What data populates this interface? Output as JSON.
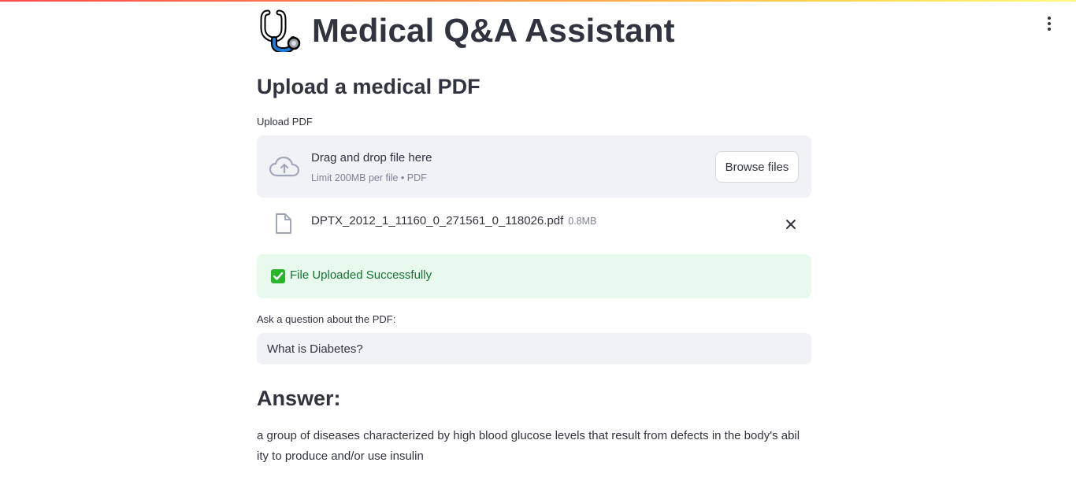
{
  "app": {
    "title": "Medical Q&A Assistant",
    "title_icon": "stethoscope-icon",
    "menu_icon": "vertical-ellipsis-icon",
    "accent_gradient": [
      "#ff4b4b",
      "#ffd24b",
      "#fffd80"
    ]
  },
  "upload": {
    "subheader": "Upload a medical PDF",
    "label": "Upload PDF",
    "dropzone_title": "Drag and drop file here",
    "dropzone_limit": "Limit 200MB per file • PDF",
    "browse_label": "Browse files",
    "upload_icon": "cloud-upload-icon"
  },
  "file": {
    "name": "DPTX_2012_1_11160_0_271561_0_118026.pdf",
    "size": "0.8MB",
    "icon": "document-icon",
    "remove_icon": "close-icon"
  },
  "status": {
    "message": "File Uploaded Successfully",
    "icon": "check-mark-button-icon",
    "color": "#177233",
    "background": "#e8f9ee"
  },
  "question": {
    "label": "Ask a question about the PDF:",
    "value": "What is Diabetes?"
  },
  "answer": {
    "heading": "Answer:",
    "text": "a group of diseases characterized by high blood glucose levels that result from defects in the body's ability to produce and/or use insulin"
  }
}
